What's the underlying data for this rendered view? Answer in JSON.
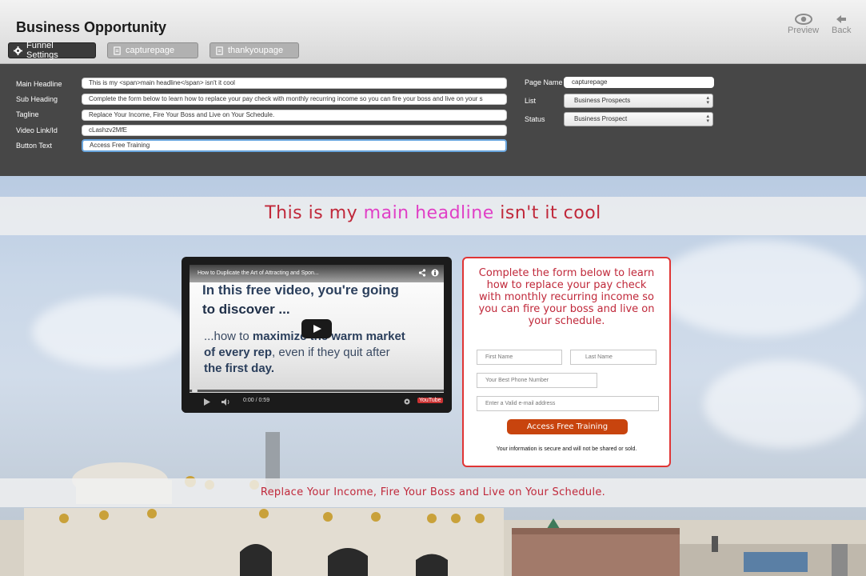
{
  "header": {
    "title": "Business Opportunity",
    "tabs": [
      {
        "label": "Funnel Settings",
        "icon": "gear-icon"
      },
      {
        "label": "capturepage",
        "icon": "page-icon"
      },
      {
        "label": "thankyoupage",
        "icon": "page-icon"
      }
    ],
    "preview_label": "Preview",
    "back_label": "Back"
  },
  "settings": {
    "fields": [
      {
        "label": "Main Headline",
        "value": "This is my <span>main headline</span> isn't it cool"
      },
      {
        "label": "Sub Heading",
        "value": "Complete the form below to learn how to replace your pay check with monthly recurring income so you can fire your boss and live on your s"
      },
      {
        "label": "Tagline",
        "value": "Replace Your Income, Fire Your Boss and Live on Your Schedule."
      },
      {
        "label": "Video Link/Id",
        "value": "cLashzv2MfE"
      },
      {
        "label": "Button Text",
        "value": "Access Free Training"
      }
    ],
    "page_name": {
      "label": "Page Name",
      "value": "capturepage"
    },
    "list": {
      "label": "List",
      "value": "Business Prospects"
    },
    "status": {
      "label": "Status",
      "value": "Business Prospect"
    }
  },
  "page": {
    "headline_pre": "This is my ",
    "headline_highlight": "main headline",
    "headline_post": " isn't it cool",
    "tagline": "Replace Your Income, Fire Your Boss and Live on Your Schedule.",
    "video": {
      "title": "How to Duplicate the Art of Attracting and Spon...",
      "line1": "In this free video, you're going",
      "line2": "to discover ...",
      "line3a": "...how to ",
      "line3b": "maximize the warm market",
      "line4a": "of every rep",
      "line4b": ", even if they quit after",
      "line5": "the first day.",
      "time": "0:00 / 0:59",
      "brand": "YouTube"
    },
    "form": {
      "heading": "Complete the form below to learn how to replace your pay check with monthly recurring income so you can fire your boss and live on your schedule.",
      "first_name_placeholder": "First Name",
      "last_name_placeholder": "Last Name",
      "phone_placeholder": "Your Best Phone Number",
      "email_placeholder": "Enter a Valid e-mail address",
      "button": "Access Free Training",
      "note": "Your information is secure and will not be shared or sold."
    }
  }
}
